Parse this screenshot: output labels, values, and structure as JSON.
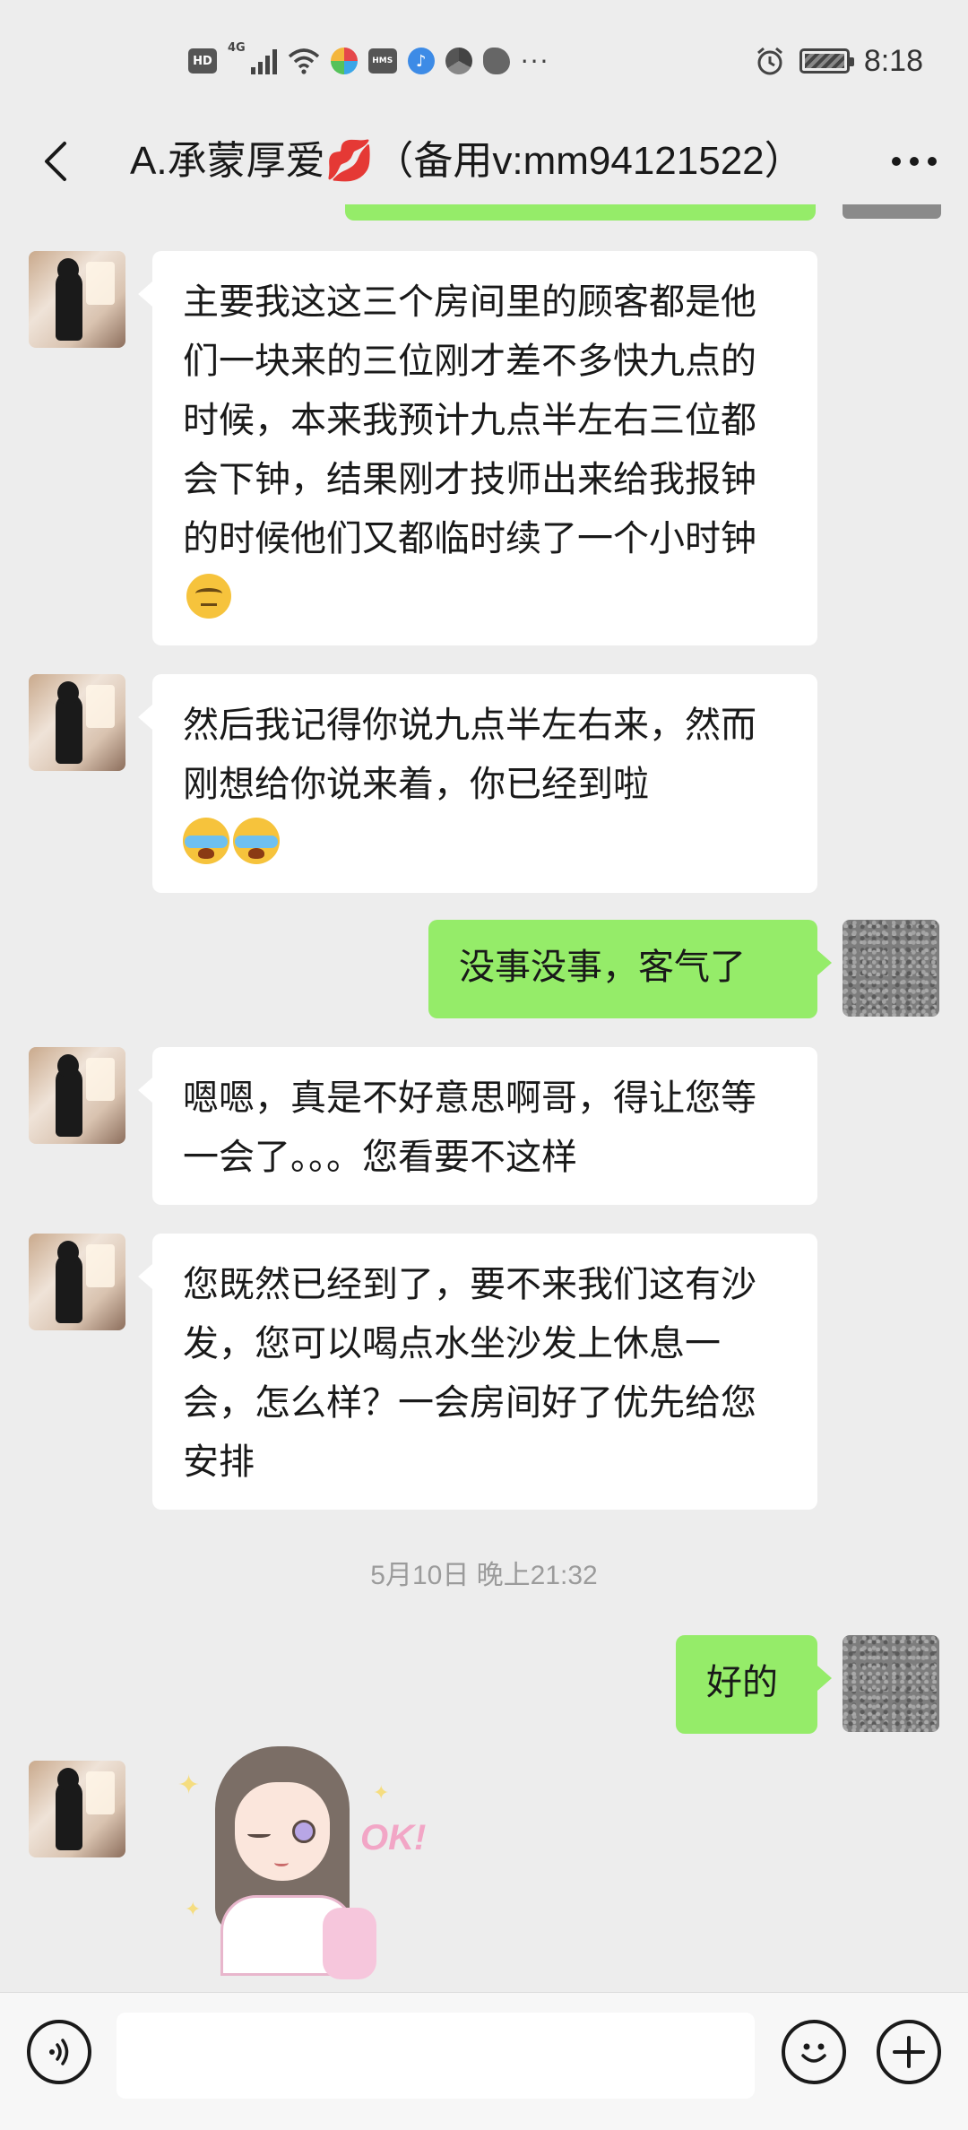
{
  "status_bar": {
    "hd": "HD",
    "network": "4G",
    "hms": "HMS",
    "more": "···",
    "time": "8:18"
  },
  "header": {
    "title": "A.承蒙厚爱💋（备用v:mm94121522）"
  },
  "messages": [
    {
      "side": "in",
      "text": "主要我这这三个房间里的顾客都是他们一块来的三位刚才差不多快九点的时候，本来我预计九点半左右三位都会下钟，结果刚才技师出来给我报钟的时候他们又都临时续了一个小时钟",
      "emoji": "eye-roll-emoji"
    },
    {
      "side": "in",
      "text": "然后我记得你说九点半左右来，然而刚想给你说来着，你已经到啦",
      "emoji": "crying-emoji x2"
    },
    {
      "side": "out",
      "text": "没事没事，客气了"
    },
    {
      "side": "in",
      "text": "嗯嗯，真是不好意思啊哥，得让您等一会了。。。您看要不这样"
    },
    {
      "side": "in",
      "text": "您既然已经到了，要不来我们这有沙发，您可以喝点水坐沙发上休息一会，怎么样？一会房间好了优先给您安排"
    },
    {
      "side": "out",
      "text": "好的"
    }
  ],
  "timestamp": "5月10日 晚上21:32",
  "sticker": {
    "text": "OK!"
  },
  "colors": {
    "background": "#ededed",
    "incoming_bubble": "#ffffff",
    "outgoing_bubble": "#95ec69",
    "timestamp": "#9b9b9b"
  },
  "icons": {
    "back": "chevron-left-icon",
    "more": "more-horizontal-icon",
    "voice": "voice-icon",
    "emoji": "smiley-icon",
    "add": "plus-circle-icon"
  }
}
